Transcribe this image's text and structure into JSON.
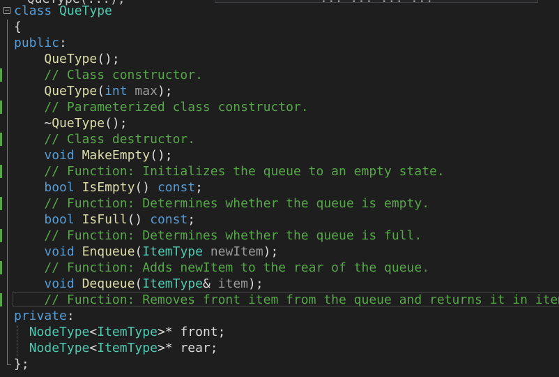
{
  "editor": {
    "top_partial_text": "~QueType(...);",
    "search_text": "... ... ... ..."
  },
  "lines": [
    {
      "id": "l1",
      "parts": [
        {
          "t": "class ",
          "c": "kw"
        },
        {
          "t": "QueType",
          "c": "cls"
        }
      ]
    },
    {
      "id": "l2",
      "parts": [
        {
          "t": "{",
          "c": "pl"
        }
      ]
    },
    {
      "id": "l3",
      "parts": [
        {
          "t": "public",
          "c": "kw"
        },
        {
          "t": ":",
          "c": "pl"
        }
      ]
    },
    {
      "id": "l4",
      "parts": [
        {
          "t": "    ",
          "c": "pl"
        },
        {
          "t": "QueType",
          "c": "fn"
        },
        {
          "t": "();",
          "c": "pl"
        }
      ]
    },
    {
      "id": "l5",
      "parts": [
        {
          "t": "    // Class constructor.",
          "c": "cm"
        }
      ]
    },
    {
      "id": "l6",
      "parts": [
        {
          "t": "    ",
          "c": "pl"
        },
        {
          "t": "QueType",
          "c": "fn"
        },
        {
          "t": "(",
          "c": "pl"
        },
        {
          "t": "int",
          "c": "kw"
        },
        {
          "t": " ",
          "c": "pl"
        },
        {
          "t": "max",
          "c": "param"
        },
        {
          "t": ");",
          "c": "pl"
        }
      ]
    },
    {
      "id": "l7",
      "parts": [
        {
          "t": "    // Parameterized class constructor.",
          "c": "cm"
        }
      ]
    },
    {
      "id": "l8",
      "parts": [
        {
          "t": "    ~",
          "c": "pl"
        },
        {
          "t": "QueType",
          "c": "fn"
        },
        {
          "t": "();",
          "c": "pl"
        }
      ]
    },
    {
      "id": "l9",
      "parts": [
        {
          "t": "    // Class destructor.",
          "c": "cm"
        }
      ]
    },
    {
      "id": "l10",
      "parts": [
        {
          "t": "    ",
          "c": "pl"
        },
        {
          "t": "void",
          "c": "kw"
        },
        {
          "t": " ",
          "c": "pl"
        },
        {
          "t": "MakeEmpty",
          "c": "fn"
        },
        {
          "t": "();",
          "c": "pl"
        }
      ]
    },
    {
      "id": "l11",
      "parts": [
        {
          "t": "    // Function: Initializes the queue to an empty state.",
          "c": "cm"
        }
      ]
    },
    {
      "id": "l12",
      "parts": [
        {
          "t": "    ",
          "c": "pl"
        },
        {
          "t": "bool",
          "c": "kw"
        },
        {
          "t": " ",
          "c": "pl"
        },
        {
          "t": "IsEmpty",
          "c": "fn"
        },
        {
          "t": "() ",
          "c": "pl"
        },
        {
          "t": "const",
          "c": "kw"
        },
        {
          "t": ";",
          "c": "pl"
        }
      ]
    },
    {
      "id": "l13",
      "parts": [
        {
          "t": "    // Function: Determines whether the queue is empty.",
          "c": "cm"
        }
      ]
    },
    {
      "id": "l14",
      "parts": [
        {
          "t": "    ",
          "c": "pl"
        },
        {
          "t": "bool",
          "c": "kw"
        },
        {
          "t": " ",
          "c": "pl"
        },
        {
          "t": "IsFull",
          "c": "fn"
        },
        {
          "t": "() ",
          "c": "pl"
        },
        {
          "t": "const",
          "c": "kw"
        },
        {
          "t": ";",
          "c": "pl"
        }
      ]
    },
    {
      "id": "l15",
      "parts": [
        {
          "t": "    // Function: Determines whether the queue is full.",
          "c": "cm"
        }
      ]
    },
    {
      "id": "l16",
      "parts": [
        {
          "t": "    ",
          "c": "pl"
        },
        {
          "t": "void",
          "c": "kw"
        },
        {
          "t": " ",
          "c": "pl"
        },
        {
          "t": "Enqueue",
          "c": "fn"
        },
        {
          "t": "(",
          "c": "pl"
        },
        {
          "t": "ItemType",
          "c": "type"
        },
        {
          "t": " ",
          "c": "pl"
        },
        {
          "t": "newItem",
          "c": "param"
        },
        {
          "t": ");",
          "c": "pl"
        }
      ]
    },
    {
      "id": "l17",
      "parts": [
        {
          "t": "    // Function: Adds newItem to the rear of the queue.",
          "c": "cm"
        }
      ]
    },
    {
      "id": "l18",
      "parts": [
        {
          "t": "    ",
          "c": "pl"
        },
        {
          "t": "void",
          "c": "kw"
        },
        {
          "t": " ",
          "c": "pl"
        },
        {
          "t": "Dequeue",
          "c": "fn"
        },
        {
          "t": "(",
          "c": "pl"
        },
        {
          "t": "ItemType",
          "c": "type"
        },
        {
          "t": "& ",
          "c": "pl"
        },
        {
          "t": "item",
          "c": "param"
        },
        {
          "t": ");",
          "c": "pl"
        }
      ]
    },
    {
      "id": "l19",
      "parts": [
        {
          "t": "    // Function: Removes front item from the queue and returns it in item",
          "c": "cm"
        }
      ]
    },
    {
      "id": "l20",
      "parts": [
        {
          "t": "private",
          "c": "kw"
        },
        {
          "t": ":",
          "c": "pl"
        }
      ]
    },
    {
      "id": "l21",
      "parts": [
        {
          "t": "  ",
          "c": "pl"
        },
        {
          "t": "NodeType",
          "c": "type"
        },
        {
          "t": "<",
          "c": "pl"
        },
        {
          "t": "ItemType",
          "c": "type"
        },
        {
          "t": ">* front;",
          "c": "pl"
        }
      ]
    },
    {
      "id": "l22",
      "parts": [
        {
          "t": "  ",
          "c": "pl"
        },
        {
          "t": "NodeType",
          "c": "type"
        },
        {
          "t": "<",
          "c": "pl"
        },
        {
          "t": "ItemType",
          "c": "type"
        },
        {
          "t": ">* rear;",
          "c": "pl"
        }
      ]
    },
    {
      "id": "l23",
      "parts": [
        {
          "t": "};",
          "c": "pl"
        }
      ]
    }
  ],
  "change_bar_lines": [
    5,
    7,
    9,
    11,
    13,
    15,
    17,
    19
  ],
  "colors": {
    "background": "#1e1e1e",
    "keyword": "#569cd6",
    "type": "#4ec9b0",
    "function": "#dcdcaa",
    "comment": "#57a64a",
    "plain": "#dcdcdc",
    "parameter": "#9a9a9a",
    "change_bar": "#57a64a"
  }
}
